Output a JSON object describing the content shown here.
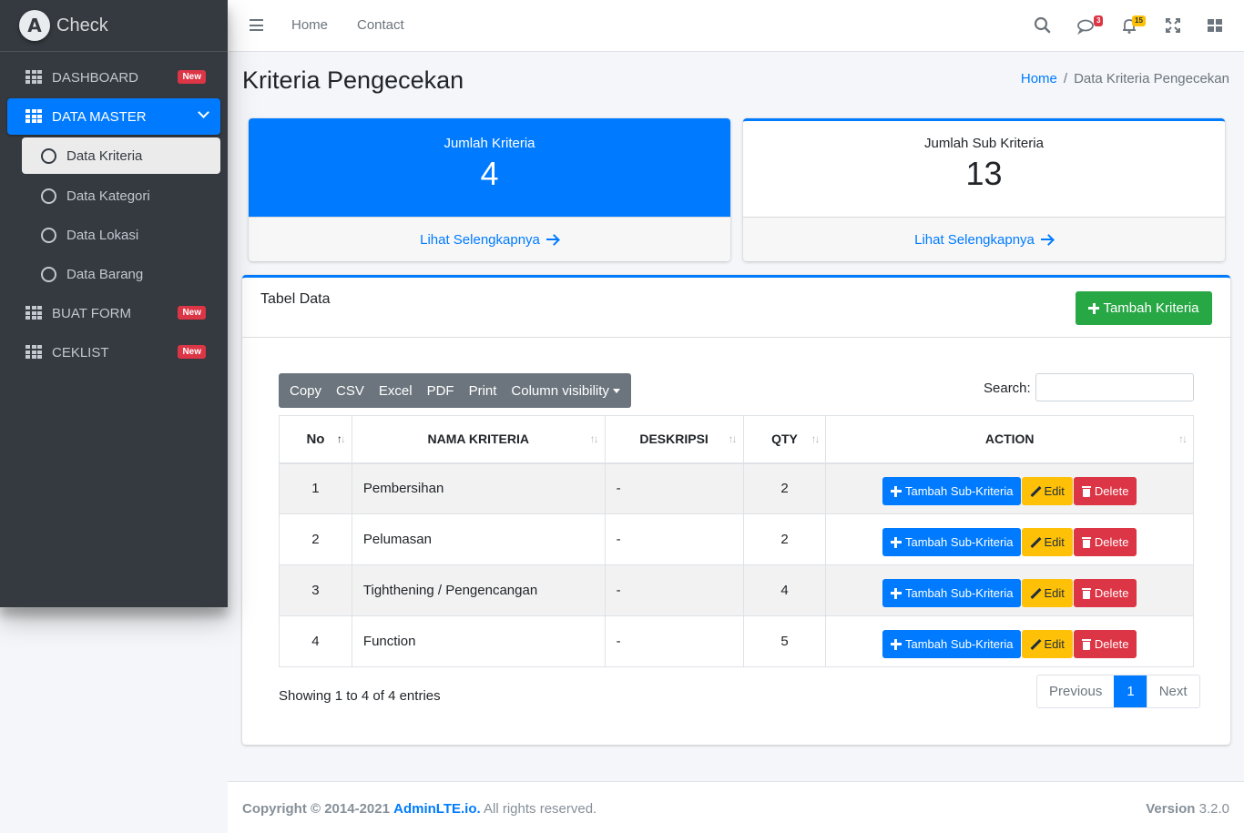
{
  "brand": {
    "logo_letter": "A",
    "name": "Check"
  },
  "sidebar": {
    "items": [
      {
        "label": "DASHBOARD",
        "badge": "New"
      },
      {
        "label": "DATA MASTER"
      },
      {
        "label": "BUAT FORM",
        "badge": "New"
      },
      {
        "label": "CEKLIST",
        "badge": "New"
      }
    ],
    "sub_items": [
      {
        "label": "Data Kriteria"
      },
      {
        "label": "Data Kategori"
      },
      {
        "label": "Data Lokasi"
      },
      {
        "label": "Data Barang"
      }
    ]
  },
  "topbar": {
    "links": [
      "Home",
      "Contact"
    ],
    "messages_count": "3",
    "notifications_count": "15"
  },
  "header": {
    "title": "Kriteria Pengecekan",
    "breadcrumb": [
      "Home",
      "Data Kriteria Pengecekan"
    ]
  },
  "info_boxes": [
    {
      "title": "Jumlah Kriteria",
      "value": "4",
      "link": "Lihat Selengkapnya"
    },
    {
      "title": "Jumlah Sub Kriteria",
      "value": "13",
      "link": "Lihat Selengkapnya"
    }
  ],
  "card": {
    "title": "Tabel Data",
    "add_button": "Tambah Kriteria",
    "export_buttons": [
      "Copy",
      "CSV",
      "Excel",
      "PDF",
      "Print",
      "Column visibility"
    ],
    "search_label": "Search:",
    "search_value": ""
  },
  "table": {
    "columns": [
      "No",
      "NAMA KRITERIA",
      "DESKRIPSI",
      "QTY",
      "ACTION"
    ],
    "rows": [
      {
        "no": "1",
        "nama": "Pembersihan",
        "deskripsi": "-",
        "qty": "2"
      },
      {
        "no": "2",
        "nama": "Pelumasan",
        "deskripsi": "-",
        "qty": "2"
      },
      {
        "no": "3",
        "nama": "Tighthening / Pengencangan",
        "deskripsi": "-",
        "qty": "4"
      },
      {
        "no": "4",
        "nama": "Function",
        "deskripsi": "-",
        "qty": "5"
      }
    ],
    "action_labels": {
      "add_sub": "Tambah Sub-Kriteria",
      "edit": "Edit",
      "delete": "Delete"
    }
  },
  "pagination": {
    "info": "Showing 1 to 4 of 4 entries",
    "previous": "Previous",
    "current": "1",
    "next": "Next"
  },
  "footer": {
    "copyright_prefix": "Copyright © 2014-2021",
    "copyright_link": "AdminLTE.io.",
    "copyright_suffix": "All rights reserved.",
    "version_label": "Version",
    "version_value": "3.2.0"
  },
  "colors": {
    "primary": "#007bff",
    "success": "#28a745",
    "warning": "#ffc107",
    "danger": "#dc3545",
    "sidebar_bg": "#343a40"
  }
}
